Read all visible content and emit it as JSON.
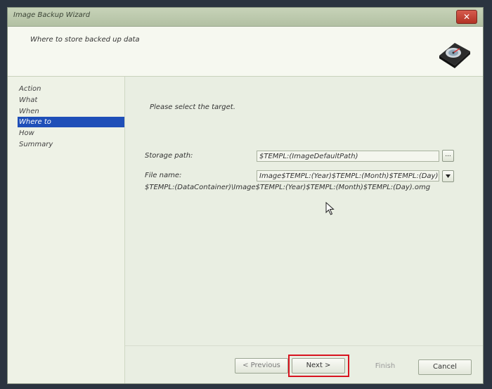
{
  "window": {
    "title": "Image Backup Wizard"
  },
  "header": {
    "title": "Where to store backed up data"
  },
  "sidebar": {
    "items": [
      {
        "label": "Action",
        "active": false
      },
      {
        "label": "What",
        "active": false
      },
      {
        "label": "When",
        "active": false
      },
      {
        "label": "Where to",
        "active": true
      },
      {
        "label": "How",
        "active": false
      },
      {
        "label": "Summary",
        "active": false
      }
    ]
  },
  "main": {
    "prompt": "Please select the target.",
    "storage_path": {
      "label": "Storage path:",
      "value": "$TEMPL:(ImageDefaultPath)",
      "browse_label": "..."
    },
    "file_name": {
      "label": "File name:",
      "value": "Image$TEMPL:(Year)$TEMPL:(Month)$TEMPL:(Day).omg"
    },
    "preview_path": "$TEMPL:(DataContainer)\\Image$TEMPL:(Year)$TEMPL:(Month)$TEMPL:(Day).omg"
  },
  "footer": {
    "previous_label": "< Previous",
    "next_label": "Next >",
    "finish_label": "Finish",
    "cancel_label": "Cancel"
  },
  "colors": {
    "accent": "#1f4fb8",
    "highlight": "#d8141f"
  }
}
